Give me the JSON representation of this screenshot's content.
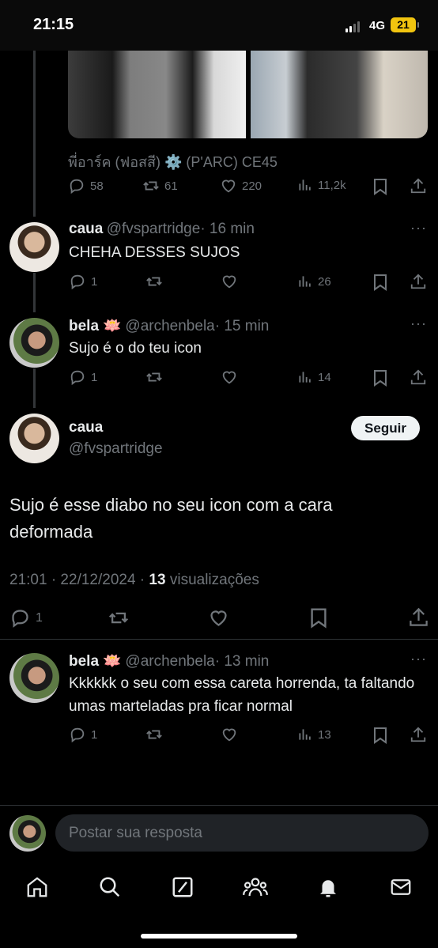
{
  "status_bar": {
    "time": "21:15",
    "network": "4G",
    "battery": "21"
  },
  "original_tweet": {
    "author_display": "พี่อาร์ค (ฟอสสี) ⚙️ (P'ARC) CE45",
    "replies": "58",
    "retweets": "61",
    "likes": "220",
    "views": "11,2k"
  },
  "reply1": {
    "name": "caua",
    "handle": "@fvspartridge",
    "time": "· 16 min",
    "text": "CHEHA DESSES SUJOS",
    "replies": "1",
    "views": "26"
  },
  "reply2": {
    "name": "bela 🪷",
    "handle": "@archenbela",
    "time": "· 15 min",
    "text": "Sujo é o do teu icon",
    "replies": "1",
    "views": "14"
  },
  "focused": {
    "name": "caua",
    "handle": "@fvspartridge",
    "follow_label": "Seguir",
    "text": "Sujo é esse diabo no seu icon com a cara deformada",
    "timestamp": "21:01 · 22/12/2024 · ",
    "views_count": "13",
    "views_label": " visualizações",
    "replies": "1"
  },
  "reply3": {
    "name": "bela 🪷",
    "handle": "@archenbela",
    "time": "· 13 min",
    "text": "Kkkkkk o seu com essa careta horrenda,  ta faltando umas marteladas pra ficar normal",
    "replies": "1",
    "views": "13"
  },
  "composer": {
    "placeholder": "Postar sua resposta"
  },
  "bottom_nav": [
    "home-icon",
    "search-icon",
    "grok-icon",
    "communities-icon",
    "notifications-icon",
    "messages-icon"
  ]
}
